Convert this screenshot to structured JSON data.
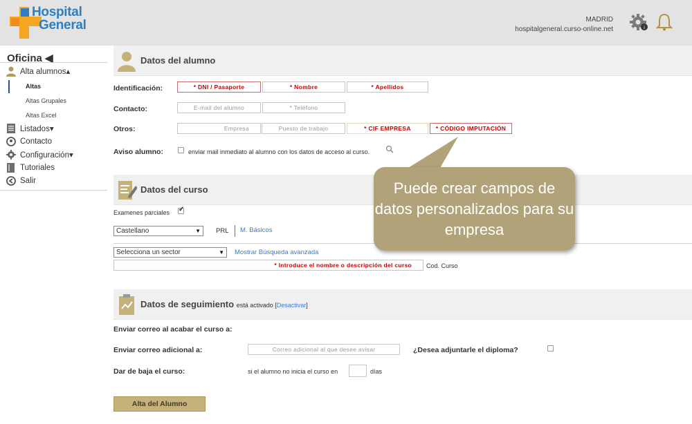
{
  "brand": {
    "line1": "Hospital",
    "line2": "General"
  },
  "header": {
    "city": "MADRID",
    "domain": "hospitalgeneral.curso-online.net",
    "settings_icon": "gear-info-icon",
    "notifications_icon": "bell-icon"
  },
  "sidebar": {
    "title": "Oficina ◀",
    "items": [
      {
        "label": "Alta alumnos▴",
        "icon": "user-icon"
      },
      {
        "label": "Listados▾",
        "icon": "list-icon"
      },
      {
        "label": "Contacto",
        "icon": "person-contact-icon"
      },
      {
        "label": "Configuración▾",
        "icon": "gear-icon"
      },
      {
        "label": "Tutoriales",
        "icon": "book-icon"
      },
      {
        "label": "Salir",
        "icon": "exit-icon"
      }
    ],
    "subitems": [
      "Altas",
      "Altas Grupales",
      "Altas Excel"
    ]
  },
  "alumno": {
    "title": "Datos del alumno",
    "lbl_ident": "Identificación:",
    "lbl_contacto": "Contacto:",
    "lbl_otros": "Otros:",
    "lbl_aviso": "Aviso alumno:",
    "dni": "* DNI / Pasaporte",
    "nombre": "* Nombre",
    "apellidos": "* Apellidos",
    "email": "E-mail del alumno",
    "telefono": "* Teléfono",
    "empresa": "Empresa",
    "puesto": "Puesto de trabajo",
    "cif": "* CIF EMPRESA",
    "codigo": "* CÓDIGO IMPUTACIÓN",
    "aviso_text": "enviar mail inmediato al alumno con los datos de acceso al curso."
  },
  "curso": {
    "title": "Datos del curso",
    "examenes": "Examenes parciales",
    "idioma": "Castellano",
    "prl": "PRL",
    "basicos": "M. Básicos",
    "sector": "Selecciona un sector",
    "busqueda": "Mostrar Búsqueda avanzada",
    "nombre_curso": "* Introduce el nombre o descripción del curso",
    "cod_curso": "Cod. Curso"
  },
  "seguimiento": {
    "title": "Datos de seguimiento",
    "status": "está activado",
    "desactivar": "Desactivar",
    "lbl_enviar": "Enviar correo al acabar el curso a:",
    "lbl_adicional": "Enviar correo adicional a:",
    "correo_placeholder": "Correo adicional al que desee avisar",
    "diploma": "¿Desea adjuntarle el diploma?",
    "lbl_baja": "Dar de baja el curso:",
    "baja_text": "si el alumno no inicia el curso en",
    "dias": "días"
  },
  "submit": "Alta del Alumno",
  "callout": "Puede crear campos de datos personalizados para su empresa"
}
